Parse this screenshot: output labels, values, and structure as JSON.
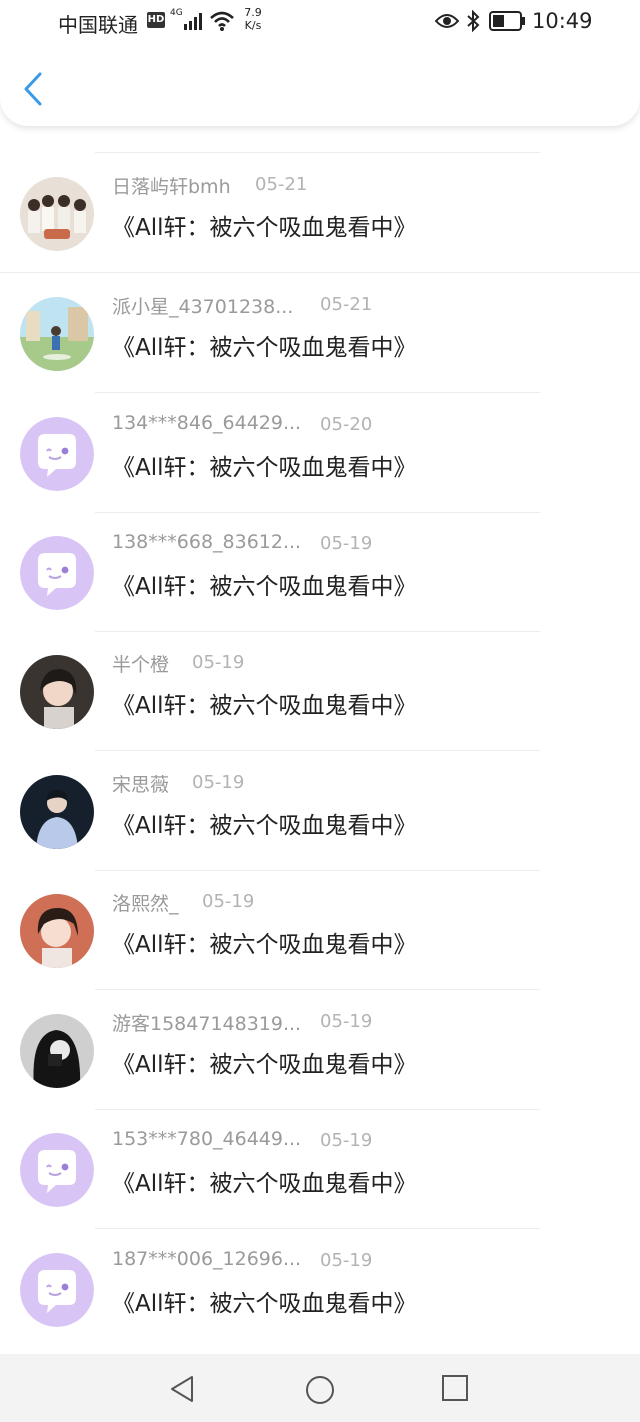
{
  "status_bar": {
    "carrier": "中国联通",
    "hd": "HD",
    "network": "4G",
    "speed_value": "7.9",
    "speed_unit": "K/s",
    "time": "10:49"
  },
  "header": {
    "back_icon": "chevron-left-icon",
    "accent_color": "#3a9ae8"
  },
  "list": {
    "items": [
      {
        "user": "日落屿轩bmh",
        "date": "05-21",
        "title": "《All轩：被六个吸血鬼看中》",
        "avatar": "group-photo"
      },
      {
        "user": "派小星_43701238...",
        "date": "05-21",
        "title": "《All轩：被六个吸血鬼看中》",
        "avatar": "anime-scene"
      },
      {
        "user": "134***846_64429...",
        "date": "05-20",
        "title": "《All轩：被六个吸血鬼看中》",
        "avatar": "default-chat-icon"
      },
      {
        "user": "138***668_83612...",
        "date": "05-19",
        "title": "《All轩：被六个吸血鬼看中》",
        "avatar": "default-chat-icon"
      },
      {
        "user": "半个橙",
        "date": "05-19",
        "title": "《All轩：被六个吸血鬼看中》",
        "avatar": "portrait-girl"
      },
      {
        "user": "宋思薇",
        "date": "05-19",
        "title": "《All轩：被六个吸血鬼看中》",
        "avatar": "portrait-boy"
      },
      {
        "user": "洛熙然_",
        "date": "05-19",
        "title": "《All轩：被六个吸血鬼看中》",
        "avatar": "portrait-girl-2"
      },
      {
        "user": "游客15847148319...",
        "date": "05-19",
        "title": "《All轩：被六个吸血鬼看中》",
        "avatar": "portrait-bw"
      },
      {
        "user": "153***780_46449...",
        "date": "05-19",
        "title": "《All轩：被六个吸血鬼看中》",
        "avatar": "default-chat-icon"
      },
      {
        "user": "187***006_12696...",
        "date": "05-19",
        "title": "《All轩：被六个吸血鬼看中》",
        "avatar": "default-chat-icon"
      }
    ]
  },
  "nav_bar": {
    "back": "triangle-back-icon",
    "home": "circle-home-icon",
    "recent": "square-recent-icon"
  },
  "colors": {
    "default_avatar_bg": "#d9c5f5",
    "username": "#9a9a9a",
    "date": "#b3b3b3",
    "title": "#222222"
  }
}
